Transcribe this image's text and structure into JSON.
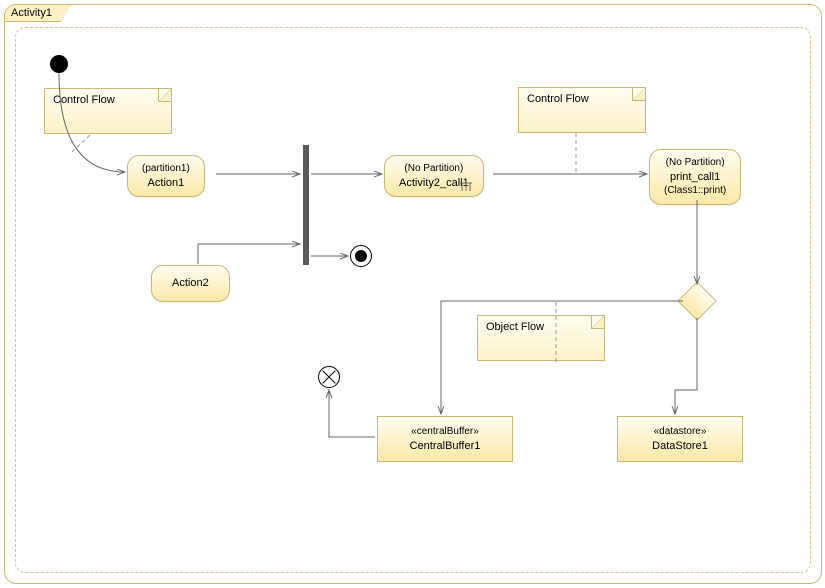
{
  "frame": {
    "title": "Activity1"
  },
  "notes": {
    "cf1": "Control Flow",
    "cf2": "Control Flow",
    "of1": "Object Flow"
  },
  "actions": {
    "action1": {
      "partition": "(partition1)",
      "label": "Action1"
    },
    "action2": {
      "label": "Action2"
    },
    "activity2": {
      "partition": "(No Partition)",
      "label": "Activity2_call1"
    },
    "print": {
      "partition": "(No Partition)",
      "label": "print_call1",
      "sub": "(Class1::print)"
    }
  },
  "objects": {
    "cb": {
      "stereo": "«centralBuffer»",
      "label": "CentralBuffer1"
    },
    "ds": {
      "stereo": "«datastore»",
      "label": "DataStore1"
    }
  },
  "chart_data": {
    "type": "uml-activity",
    "name": "Activity1",
    "nodes": [
      {
        "id": "initial",
        "kind": "InitialNode"
      },
      {
        "id": "Action1",
        "kind": "Action",
        "partition": "partition1"
      },
      {
        "id": "Action2",
        "kind": "Action"
      },
      {
        "id": "fork1",
        "kind": "ForkJoin"
      },
      {
        "id": "Activity2_call1",
        "kind": "CallBehaviorAction",
        "partition": "No Partition"
      },
      {
        "id": "final",
        "kind": "ActivityFinal"
      },
      {
        "id": "print_call1",
        "kind": "CallOperationAction",
        "operation": "Class1::print",
        "partition": "No Partition"
      },
      {
        "id": "decision1",
        "kind": "DecisionNode"
      },
      {
        "id": "CentralBuffer1",
        "kind": "CentralBufferNode"
      },
      {
        "id": "DataStore1",
        "kind": "DataStoreNode"
      },
      {
        "id": "flowfinal",
        "kind": "FlowFinal"
      }
    ],
    "edges": [
      {
        "from": "initial",
        "to": "Action1",
        "kind": "ControlFlow",
        "note": "Control Flow"
      },
      {
        "from": "Action1",
        "to": "fork1",
        "kind": "ControlFlow"
      },
      {
        "from": "Action2",
        "to": "fork1",
        "kind": "ControlFlow"
      },
      {
        "from": "fork1",
        "to": "Activity2_call1",
        "kind": "ControlFlow"
      },
      {
        "from": "fork1",
        "to": "final",
        "kind": "ControlFlow"
      },
      {
        "from": "Activity2_call1",
        "to": "print_call1",
        "kind": "ControlFlow",
        "note": "Control Flow"
      },
      {
        "from": "print_call1",
        "to": "decision1",
        "kind": "ControlFlow"
      },
      {
        "from": "decision1",
        "to": "CentralBuffer1",
        "kind": "ObjectFlow",
        "note": "Object Flow"
      },
      {
        "from": "decision1",
        "to": "DataStore1",
        "kind": "ObjectFlow"
      },
      {
        "from": "CentralBuffer1",
        "to": "flowfinal",
        "kind": "ObjectFlow"
      }
    ]
  }
}
